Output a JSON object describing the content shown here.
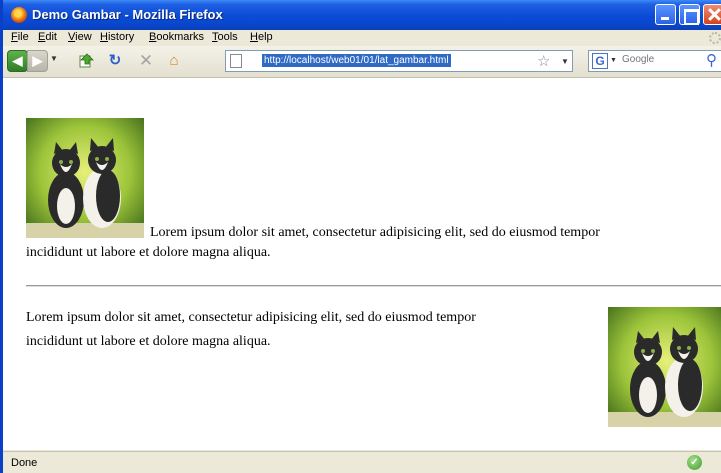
{
  "window": {
    "title": "Demo Gambar - Mozilla Firefox",
    "controls": {
      "minimize": "minimize",
      "maximize": "maximize",
      "close": "close"
    }
  },
  "menu": {
    "items": [
      "File",
      "Edit",
      "View",
      "History",
      "Bookmarks",
      "Tools",
      "Help"
    ]
  },
  "toolbar": {
    "url": "http://localhost/web01/01/lat_gambar.html",
    "search_placeholder": "Google",
    "icons": [
      "back-icon",
      "forward-icon",
      "bookmark-page-icon",
      "reload-icon",
      "stop-icon",
      "home-icon",
      "star-icon",
      "google-icon",
      "search-icon"
    ]
  },
  "content": {
    "para1_line1": "Lorem ipsum dolor sit amet, consectetur adipisicing elit, sed do eiusmod tempor",
    "para1_line2": "incididunt ut labore et dolore magna aliqua.",
    "para2_line1": "Lorem ipsum dolor sit amet, consectetur adipisicing elit, sed do eiusmod tempor",
    "para2_line2": "incididunt ut labore et dolore magna aliqua.",
    "image_subject": "two kittens on green background"
  },
  "status": {
    "text": "Done",
    "icon": "security-check-icon"
  },
  "colors": {
    "titlebar": "#0a4bd6",
    "url_highlight": "#316ac5",
    "chrome": "#ece9d8"
  }
}
